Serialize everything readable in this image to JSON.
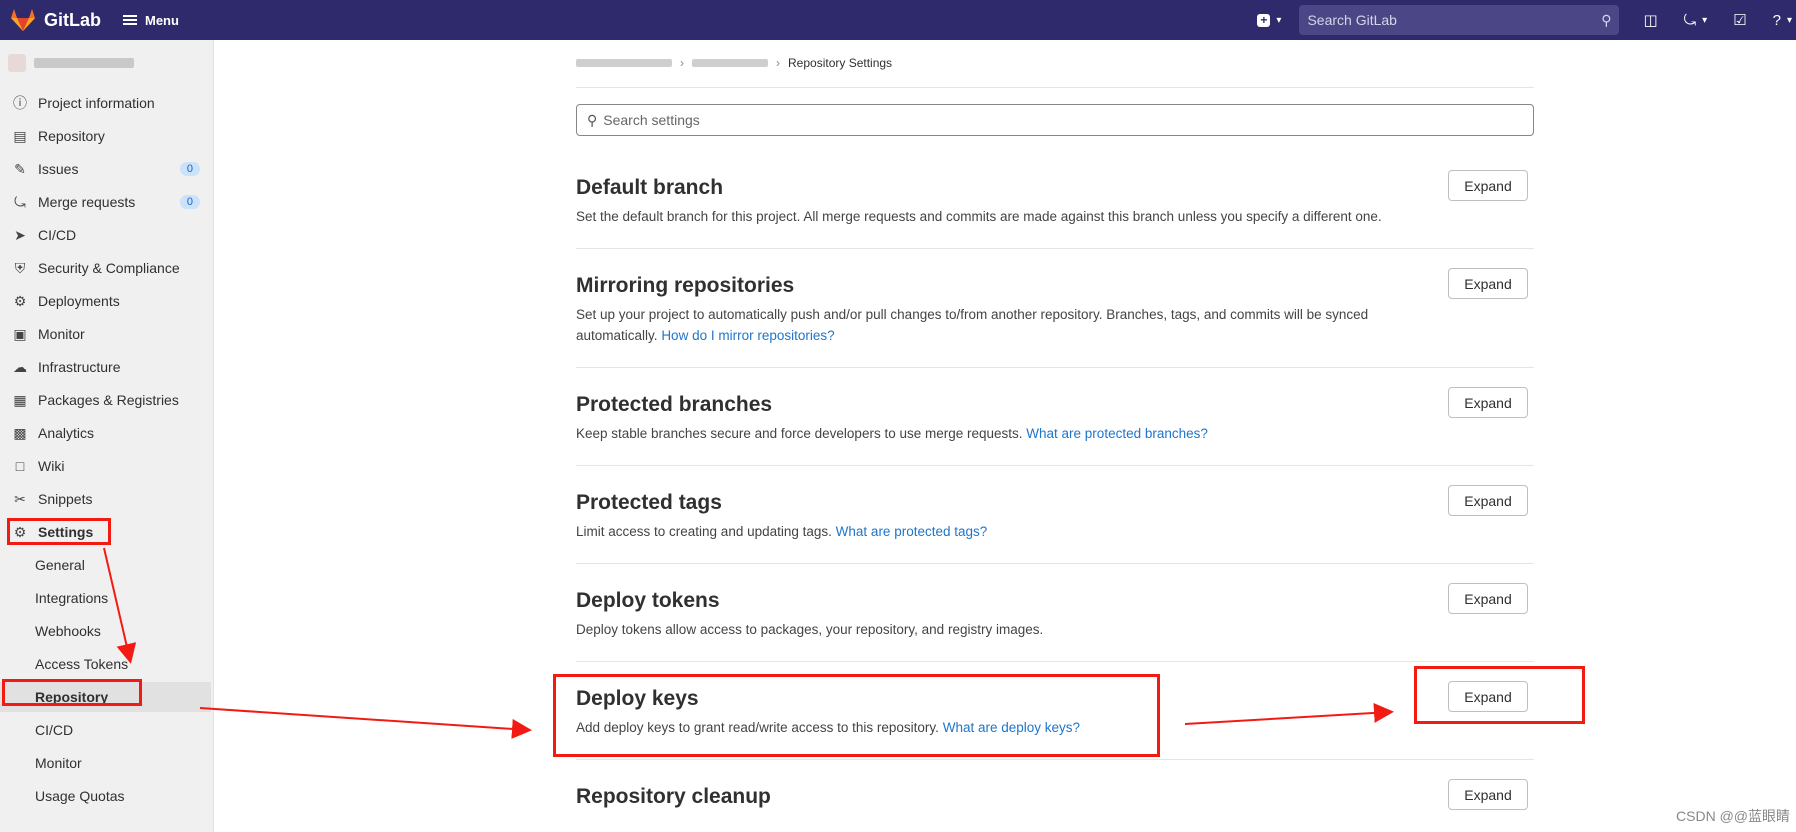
{
  "topbar": {
    "app_name": "GitLab",
    "menu_label": "Menu",
    "search_placeholder": "Search GitLab"
  },
  "sidebar": {
    "items": [
      {
        "label": "Project information",
        "icon": "info-icon"
      },
      {
        "label": "Repository",
        "icon": "book-icon"
      },
      {
        "label": "Issues",
        "icon": "issues-icon",
        "count": "0"
      },
      {
        "label": "Merge requests",
        "icon": "merge-request-icon",
        "count": "0"
      },
      {
        "label": "CI/CD",
        "icon": "rocket-icon"
      },
      {
        "label": "Security & Compliance",
        "icon": "shield-icon"
      },
      {
        "label": "Deployments",
        "icon": "deployments-icon"
      },
      {
        "label": "Monitor",
        "icon": "monitor-icon"
      },
      {
        "label": "Infrastructure",
        "icon": "cloud-gear-icon"
      },
      {
        "label": "Packages & Registries",
        "icon": "package-icon"
      },
      {
        "label": "Analytics",
        "icon": "chart-icon"
      },
      {
        "label": "Wiki",
        "icon": "wiki-icon"
      },
      {
        "label": "Snippets",
        "icon": "scissors-icon"
      },
      {
        "label": "Settings",
        "icon": "gear-icon"
      }
    ],
    "settings_sub": [
      "General",
      "Integrations",
      "Webhooks",
      "Access Tokens",
      "Repository",
      "CI/CD",
      "Monitor",
      "Usage Quotas"
    ]
  },
  "breadcrumb": {
    "current": "Repository Settings"
  },
  "search_settings": {
    "placeholder": "Search settings"
  },
  "sections": [
    {
      "title": "Default branch",
      "desc": "Set the default branch for this project. All merge requests and commits are made against this branch unless you specify a different one.",
      "link": ""
    },
    {
      "title": "Mirroring repositories",
      "desc": "Set up your project to automatically push and/or pull changes to/from another repository. Branches, tags, and commits will be synced automatically.",
      "link": "How do I mirror repositories?"
    },
    {
      "title": "Protected branches",
      "desc": "Keep stable branches secure and force developers to use merge requests.",
      "link": "What are protected branches?"
    },
    {
      "title": "Protected tags",
      "desc": "Limit access to creating and updating tags.",
      "link": "What are protected tags?"
    },
    {
      "title": "Deploy tokens",
      "desc": "Deploy tokens allow access to packages, your repository, and registry images.",
      "link": ""
    },
    {
      "title": "Deploy keys",
      "desc": "Add deploy keys to grant read/write access to this repository.",
      "link": "What are deploy keys?"
    },
    {
      "title": "Repository cleanup",
      "desc": "",
      "link": ""
    }
  ],
  "expand_label": "Expand",
  "watermark": "CSDN @@蓝眼睛",
  "colors": {
    "topbar": "#2f2a6b",
    "annotation_red": "#f21b14",
    "link": "#1f75cb"
  }
}
